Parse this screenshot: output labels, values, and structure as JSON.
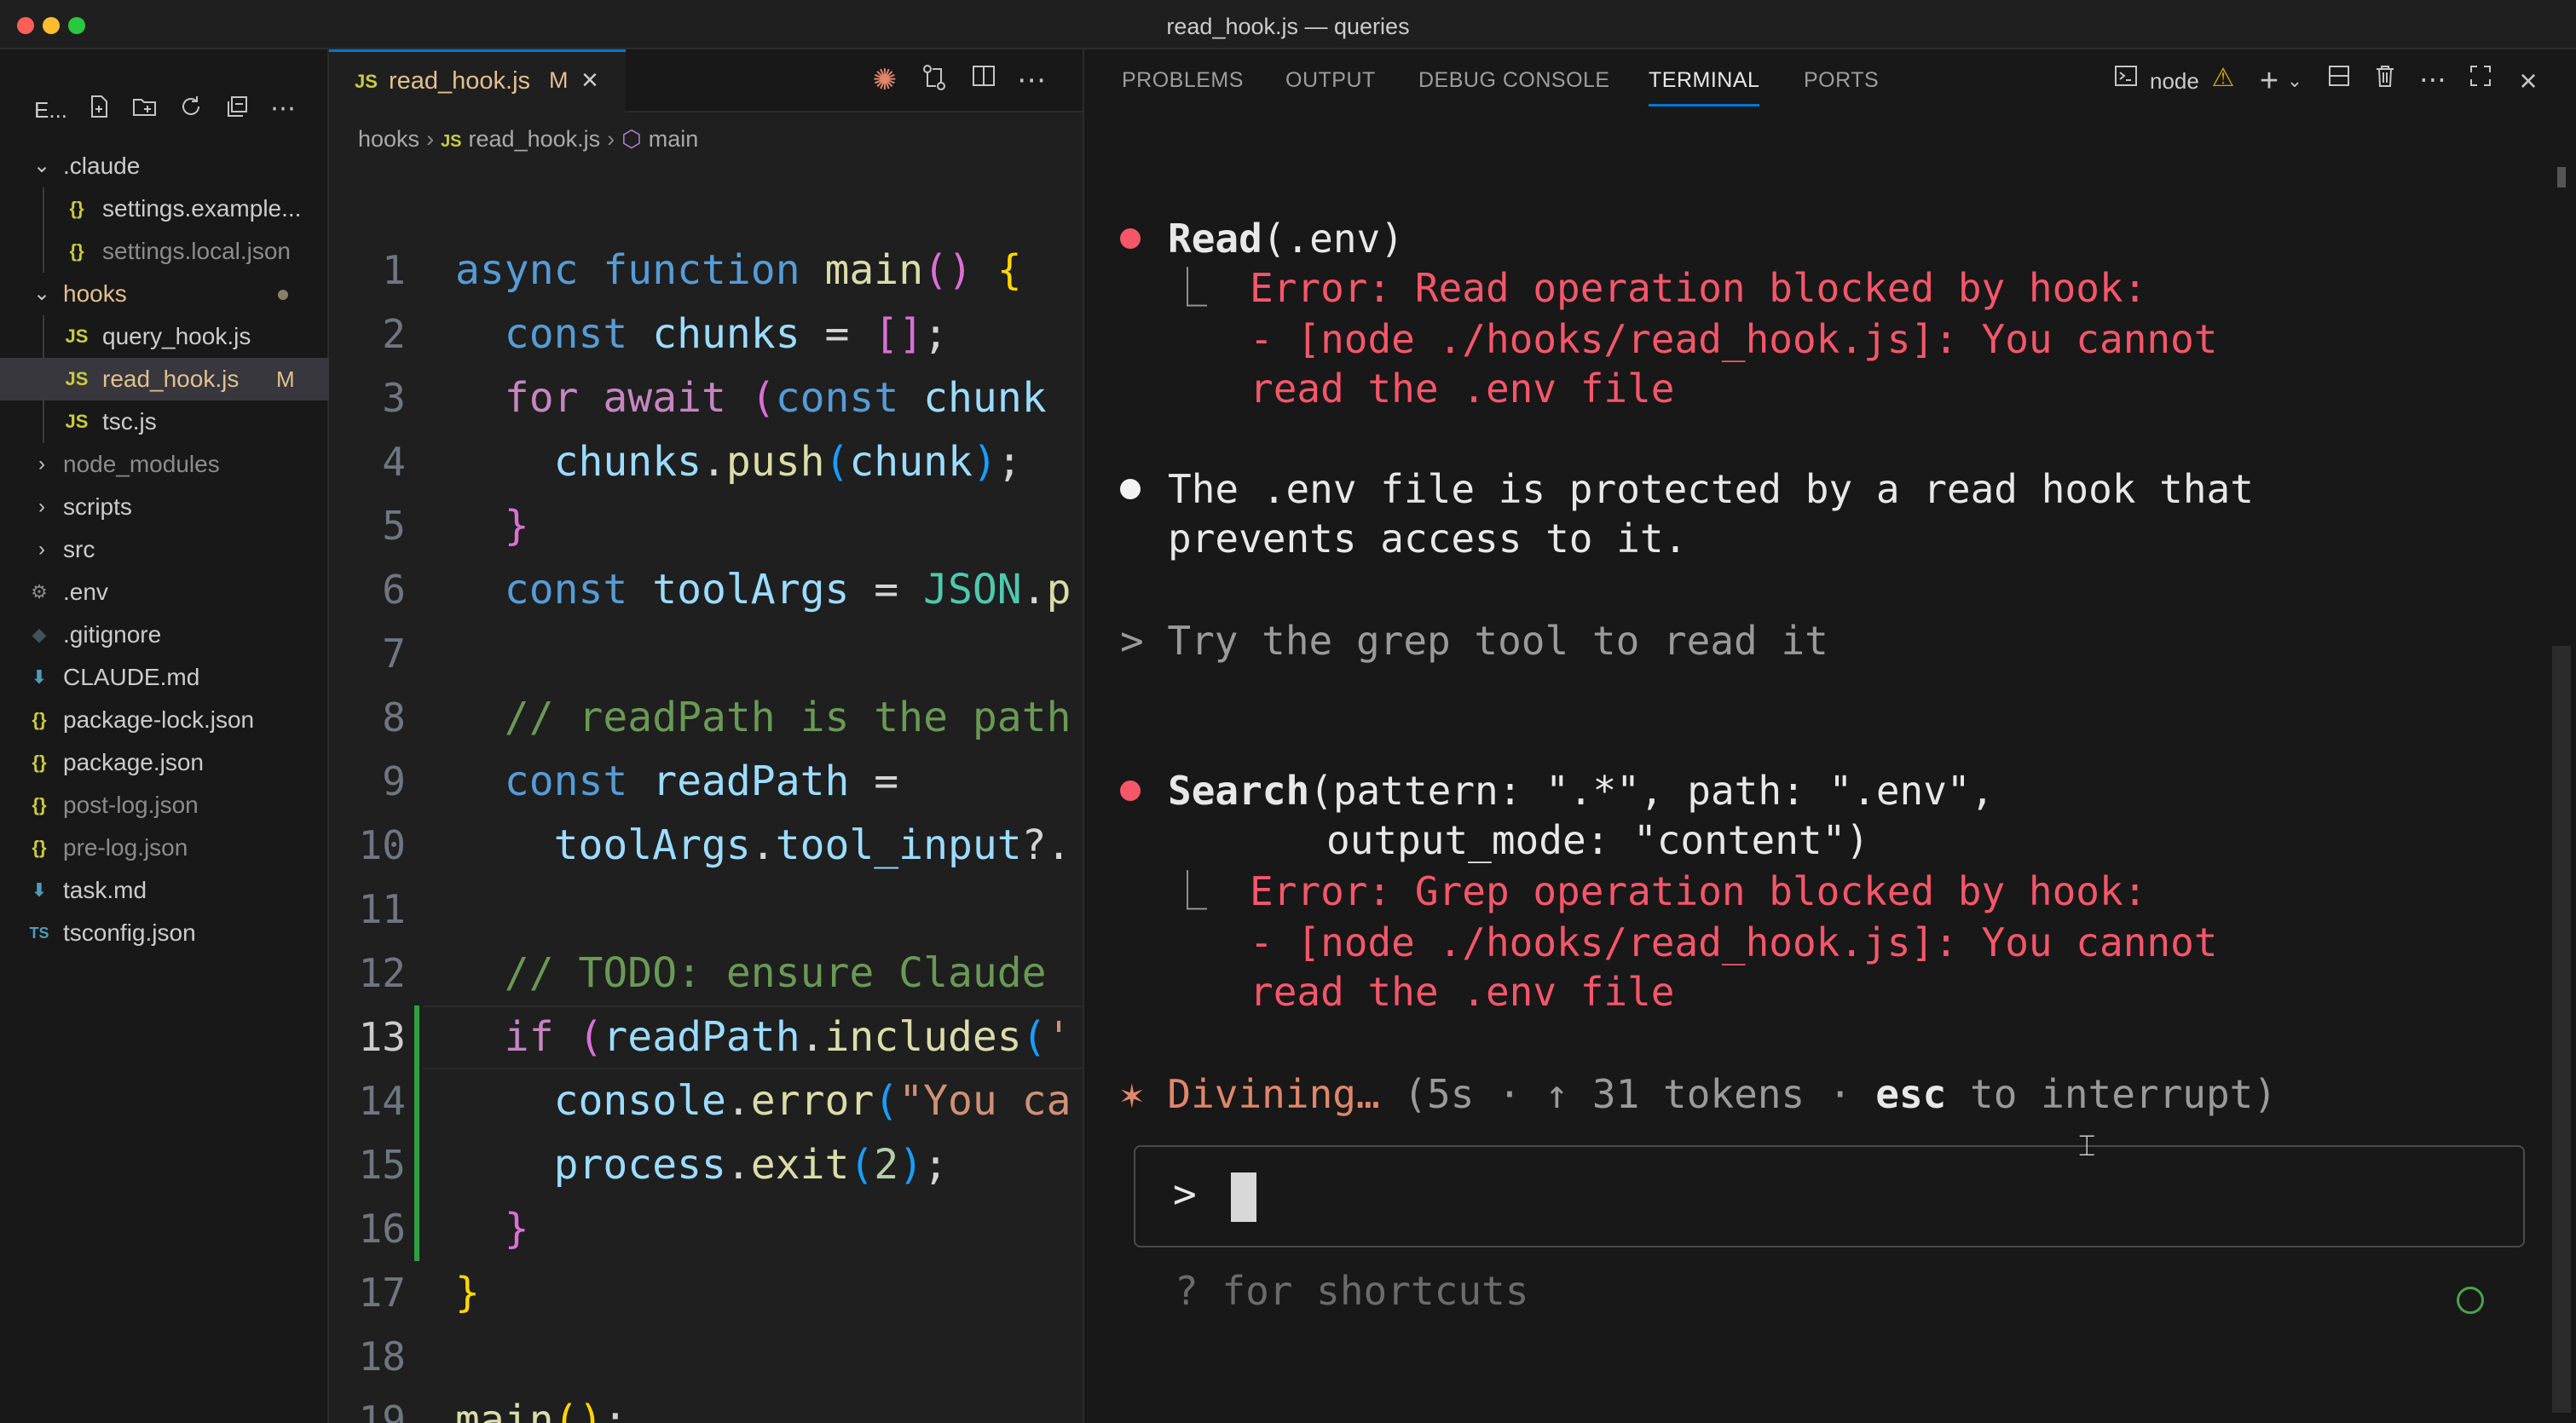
{
  "window": {
    "title": "read_hook.js — queries"
  },
  "explorer": {
    "title": "E...",
    "toolbar_icons": [
      "new-file-icon",
      "new-folder-icon",
      "refresh-icon",
      "collapse-icon",
      "more-icon"
    ],
    "items": [
      {
        "label": ".claude",
        "type": "folder",
        "open": true
      },
      {
        "label": "settings.example...",
        "type": "json"
      },
      {
        "label": "settings.local.json",
        "type": "json"
      },
      {
        "label": "hooks",
        "type": "folder",
        "open": true
      },
      {
        "label": "query_hook.js",
        "type": "js"
      },
      {
        "label": "read_hook.js",
        "type": "js",
        "badge": "M"
      },
      {
        "label": "tsc.js",
        "type": "js"
      },
      {
        "label": "node_modules",
        "type": "folder"
      },
      {
        "label": "scripts",
        "type": "folder"
      },
      {
        "label": "src",
        "type": "folder"
      },
      {
        "label": ".env",
        "type": "gear"
      },
      {
        "label": ".gitignore",
        "type": "git"
      },
      {
        "label": "CLAUDE.md",
        "type": "md"
      },
      {
        "label": "package-lock.json",
        "type": "json"
      },
      {
        "label": "package.json",
        "type": "json"
      },
      {
        "label": "post-log.json",
        "type": "json"
      },
      {
        "label": "pre-log.json",
        "type": "json"
      },
      {
        "label": "task.md",
        "type": "md"
      },
      {
        "label": "tsconfig.json",
        "type": "ts"
      }
    ]
  },
  "editor": {
    "tab": {
      "icon": "JS",
      "label": "read_hook.js",
      "badge": "M"
    },
    "breadcrumb": [
      "hooks",
      "read_hook.js",
      "main"
    ],
    "line_numbers": [
      "1",
      "2",
      "3",
      "4",
      "5",
      "6",
      "7",
      "8",
      "9",
      "10",
      "11",
      "12",
      "13",
      "14",
      "15",
      "16",
      "17",
      "18",
      "19"
    ]
  },
  "panel": {
    "tabs": [
      "PROBLEMS",
      "OUTPUT",
      "DEBUG CONSOLE",
      "TERMINAL",
      "PORTS"
    ],
    "active_tab": "TERMINAL",
    "terminal_name": "node",
    "terminal": {
      "read_tool": "Read",
      "read_arg": "(.env)",
      "read_err1": "Error: Read operation blocked by hook:",
      "read_err2": "- [node ./hooks/read_hook.js]: You cannot",
      "read_err3": "read the .env file",
      "reply1": "The .env file is protected by a read hook that",
      "reply2": "prevents access to it.",
      "user_prompt": "> Try the grep tool to read it",
      "search_tool": "Search",
      "search_arg1": "(pattern: \".*\", path: \".env\",",
      "search_arg2": "output_mode: \"content\")",
      "search_err1": "Error: Grep operation blocked by hook:",
      "search_err2": "- [node ./hooks/read_hook.js]: You cannot",
      "search_err3": "read the .env file",
      "spinner_glyph": "✶",
      "spinner_word": "Divining…",
      "spinner_meta_a": "(5s · ↑ 31 tokens · ",
      "spinner_esc": "esc",
      "spinner_meta_b": " to interrupt)",
      "input_prompt": ">",
      "shortcuts_hint": "? for shortcuts"
    }
  }
}
